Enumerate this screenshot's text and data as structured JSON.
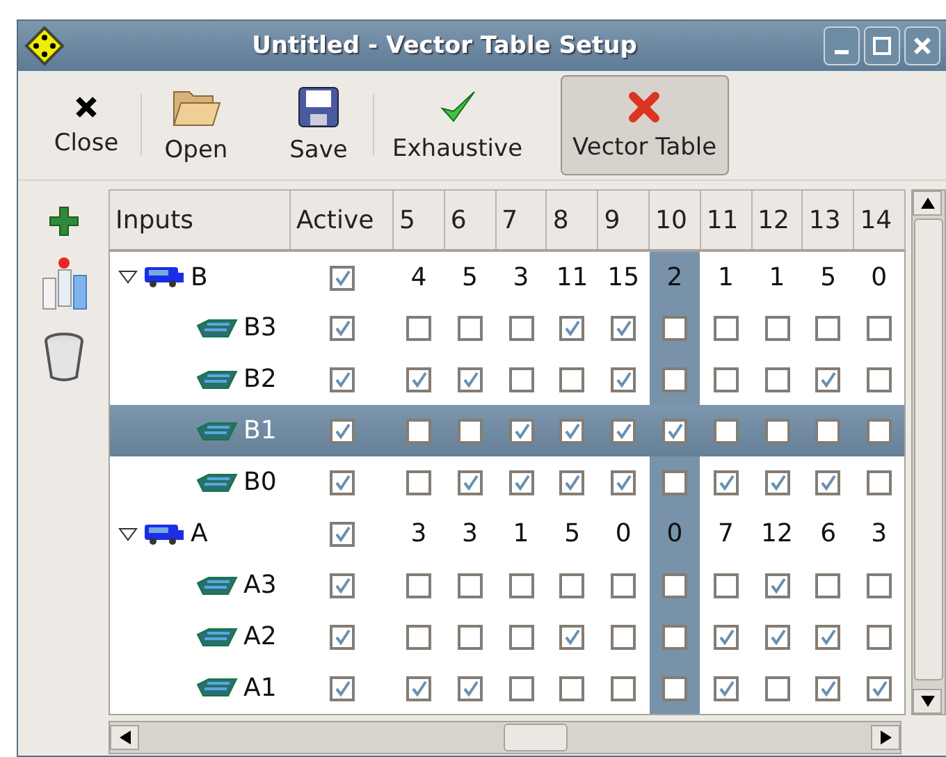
{
  "window": {
    "title": "Untitled - Vector Table Setup"
  },
  "toolbar_groups": [
    [
      {
        "label": "Close",
        "kind": "close",
        "selected": false
      }
    ],
    [
      {
        "label": "Open",
        "kind": "open",
        "selected": false
      },
      {
        "label": "Save",
        "kind": "save",
        "selected": false
      }
    ],
    [
      {
        "label": "Exhaustive",
        "kind": "exhaustive",
        "selected": false
      },
      {
        "label": "Vector Table",
        "kind": "vector",
        "selected": true
      }
    ]
  ],
  "side_tools": [
    {
      "kind": "add"
    },
    {
      "kind": "columns"
    },
    {
      "kind": "trash"
    }
  ],
  "table": {
    "columns": [
      {
        "label": "Inputs"
      },
      {
        "label": "Active"
      },
      {
        "label": "5",
        "selected": false
      },
      {
        "label": "6",
        "selected": false
      },
      {
        "label": "7",
        "selected": false
      },
      {
        "label": "8",
        "selected": false
      },
      {
        "label": "9",
        "selected": false
      },
      {
        "label": "10",
        "selected": true
      },
      {
        "label": "11",
        "selected": false
      },
      {
        "label": "12",
        "selected": false
      },
      {
        "label": "13",
        "selected": false
      },
      {
        "label": "14",
        "selected": false
      }
    ],
    "rows": [
      {
        "name": "B",
        "expanded": true,
        "active": true,
        "selected": false,
        "values": [
          "4",
          "5",
          "3",
          "11",
          "15",
          "2",
          "1",
          "1",
          "5",
          "0"
        ],
        "children": [
          {
            "name": "B3",
            "active": true,
            "selected": false,
            "bits": [
              false,
              false,
              false,
              true,
              true,
              false,
              false,
              false,
              false,
              false
            ]
          },
          {
            "name": "B2",
            "active": true,
            "selected": false,
            "bits": [
              true,
              true,
              false,
              false,
              true,
              false,
              false,
              false,
              true,
              false
            ]
          },
          {
            "name": "B1",
            "active": true,
            "selected": true,
            "bits": [
              false,
              false,
              true,
              true,
              true,
              true,
              false,
              false,
              false,
              false
            ]
          },
          {
            "name": "B0",
            "active": true,
            "selected": false,
            "bits": [
              false,
              true,
              true,
              true,
              true,
              false,
              true,
              true,
              true,
              false
            ]
          }
        ]
      },
      {
        "name": "A",
        "expanded": true,
        "active": true,
        "selected": false,
        "values": [
          "3",
          "3",
          "1",
          "5",
          "0",
          "0",
          "7",
          "12",
          "6",
          "3"
        ],
        "children": [
          {
            "name": "A3",
            "active": true,
            "selected": false,
            "bits": [
              false,
              false,
              false,
              false,
              false,
              false,
              false,
              true,
              false,
              false
            ]
          },
          {
            "name": "A2",
            "active": true,
            "selected": false,
            "bits": [
              false,
              false,
              false,
              true,
              false,
              false,
              true,
              true,
              true,
              false
            ]
          },
          {
            "name": "A1",
            "active": true,
            "selected": false,
            "bits": [
              true,
              true,
              false,
              false,
              false,
              false,
              true,
              false,
              true,
              true
            ]
          }
        ]
      }
    ]
  }
}
